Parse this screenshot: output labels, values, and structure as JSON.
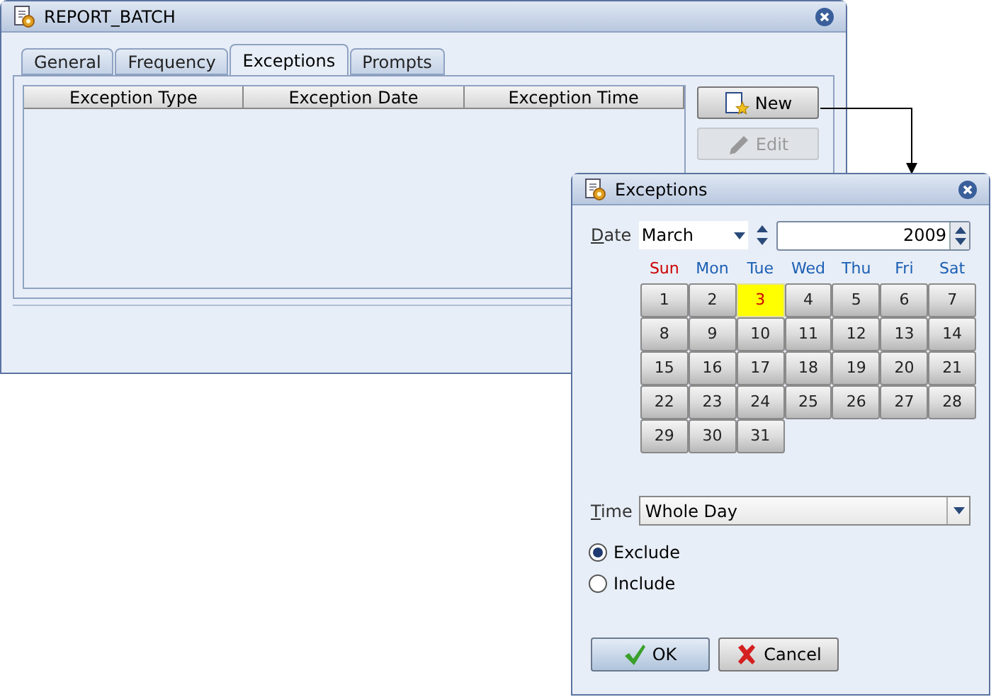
{
  "main_window": {
    "title": "REPORT_BATCH",
    "tabs": [
      {
        "label": "General",
        "selected": false
      },
      {
        "label": "Frequency",
        "selected": false
      },
      {
        "label": "Exceptions",
        "selected": true
      },
      {
        "label": "Prompts",
        "selected": false
      }
    ],
    "table": {
      "columns": [
        "Exception Type",
        "Exception Date",
        "Exception Time"
      ]
    },
    "buttons": [
      {
        "label": "New",
        "kind": "new",
        "disabled": false
      },
      {
        "label": "Edit",
        "kind": "edit",
        "disabled": true
      }
    ]
  },
  "dialog": {
    "title": "Exceptions",
    "date_label": "Date",
    "month": "March",
    "year": "2009",
    "weekdays": [
      {
        "label": "Sun",
        "color": "#cc0000"
      },
      {
        "label": "Mon",
        "color": "#1a5fb4"
      },
      {
        "label": "Tue",
        "color": "#1a5fb4"
      },
      {
        "label": "Wed",
        "color": "#1a5fb4"
      },
      {
        "label": "Thu",
        "color": "#1a5fb4"
      },
      {
        "label": "Fri",
        "color": "#1a5fb4"
      },
      {
        "label": "Sat",
        "color": "#1a5fb4"
      }
    ],
    "days": [
      {
        "label": "1",
        "selected": false
      },
      {
        "label": "2",
        "selected": false
      },
      {
        "label": "3",
        "selected": true
      },
      {
        "label": "4",
        "selected": false
      },
      {
        "label": "5",
        "selected": false
      },
      {
        "label": "6",
        "selected": false
      },
      {
        "label": "7",
        "selected": false
      },
      {
        "label": "8",
        "selected": false
      },
      {
        "label": "9",
        "selected": false
      },
      {
        "label": "10",
        "selected": false
      },
      {
        "label": "11",
        "selected": false
      },
      {
        "label": "12",
        "selected": false
      },
      {
        "label": "13",
        "selected": false
      },
      {
        "label": "14",
        "selected": false
      },
      {
        "label": "15",
        "selected": false
      },
      {
        "label": "16",
        "selected": false
      },
      {
        "label": "17",
        "selected": false
      },
      {
        "label": "18",
        "selected": false
      },
      {
        "label": "19",
        "selected": false
      },
      {
        "label": "20",
        "selected": false
      },
      {
        "label": "21",
        "selected": false
      },
      {
        "label": "22",
        "selected": false
      },
      {
        "label": "23",
        "selected": false
      },
      {
        "label": "24",
        "selected": false
      },
      {
        "label": "25",
        "selected": false
      },
      {
        "label": "26",
        "selected": false
      },
      {
        "label": "27",
        "selected": false
      },
      {
        "label": "28",
        "selected": false
      },
      {
        "label": "29",
        "selected": false
      },
      {
        "label": "30",
        "selected": false
      },
      {
        "label": "31",
        "selected": false
      }
    ],
    "time_label": "Time",
    "time_value": "Whole Day",
    "options": [
      {
        "label": "Exclude",
        "selected": true
      },
      {
        "label": "Include",
        "selected": false
      }
    ],
    "buttons": [
      {
        "label": "OK",
        "kind": "ok"
      },
      {
        "label": "Cancel",
        "kind": "cancel"
      }
    ]
  }
}
